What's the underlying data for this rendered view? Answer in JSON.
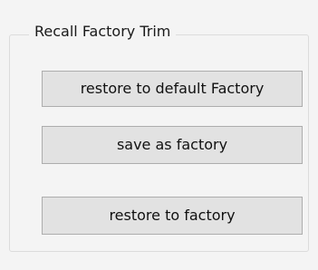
{
  "group": {
    "title": "Recall Factory Trim"
  },
  "buttons": {
    "restore_default_label": "restore to default Factory",
    "save_factory_label": "save as factory",
    "restore_factory_label": "restore to factory"
  }
}
